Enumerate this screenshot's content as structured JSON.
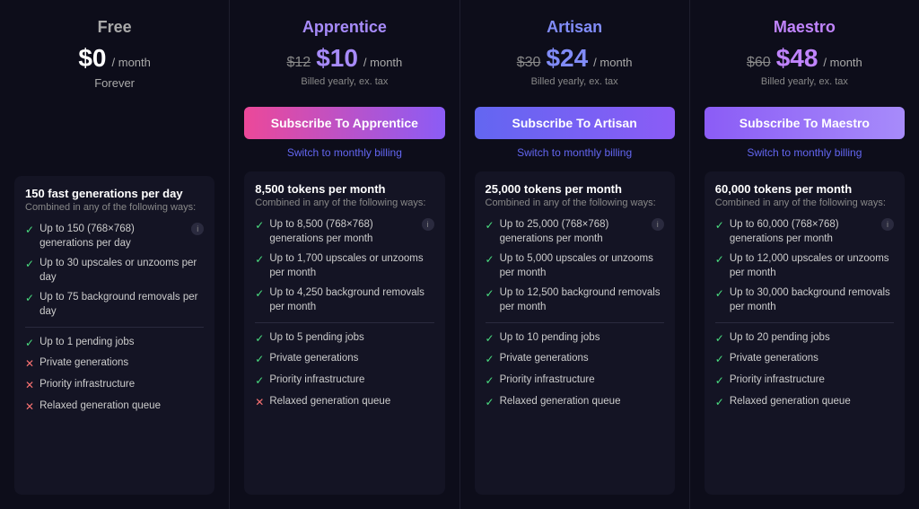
{
  "plans": [
    {
      "id": "free",
      "name": "Free",
      "name_class": "free",
      "price_original": null,
      "price_current": "$0",
      "price_current_class": "free",
      "price_period": "/ month",
      "price_note": null,
      "forever_note": "Forever",
      "subscribe_label": null,
      "switch_billing": null,
      "main_feature": "150 fast generations per day",
      "sub_feature": "Combined in any of the following ways:",
      "features_group1": [
        {
          "check": true,
          "text": "Up to 150 (768×768) generations per day",
          "info": true
        },
        {
          "check": true,
          "text": "Up to 30 upscales or unzooms per day"
        },
        {
          "check": true,
          "text": "Up to 75 background removals per day"
        }
      ],
      "features_group2": [
        {
          "check": true,
          "text": "Up to 1 pending jobs"
        },
        {
          "check": false,
          "text": "Private generations"
        },
        {
          "check": false,
          "text": "Priority infrastructure"
        },
        {
          "check": false,
          "text": "Relaxed generation queue"
        }
      ]
    },
    {
      "id": "apprentice",
      "name": "Apprentice",
      "name_class": "apprentice",
      "price_original": "$12",
      "price_current": "$10",
      "price_current_class": "apprentice",
      "price_period": "/ month",
      "price_note": "Billed yearly, ex. tax",
      "forever_note": null,
      "subscribe_label": "Subscribe To Apprentice",
      "subscribe_class": "btn-apprentice",
      "switch_billing": "Switch to monthly billing",
      "main_feature": "8,500 tokens per month",
      "sub_feature": "Combined in any of the following ways:",
      "features_group1": [
        {
          "check": true,
          "text": "Up to 8,500 (768×768) generations per month",
          "info": true
        },
        {
          "check": true,
          "text": "Up to 1,700 upscales or unzooms per month"
        },
        {
          "check": true,
          "text": "Up to 4,250 background removals per month"
        }
      ],
      "features_group2": [
        {
          "check": true,
          "text": "Up to 5 pending jobs"
        },
        {
          "check": true,
          "text": "Private generations"
        },
        {
          "check": true,
          "text": "Priority infrastructure"
        },
        {
          "check": false,
          "text": "Relaxed generation queue"
        }
      ]
    },
    {
      "id": "artisan",
      "name": "Artisan",
      "name_class": "artisan",
      "price_original": "$30",
      "price_current": "$24",
      "price_current_class": "artisan",
      "price_period": "/ month",
      "price_note": "Billed yearly, ex. tax",
      "forever_note": null,
      "subscribe_label": "Subscribe To Artisan",
      "subscribe_class": "btn-artisan",
      "switch_billing": "Switch to monthly billing",
      "main_feature": "25,000 tokens per month",
      "sub_feature": "Combined in any of the following ways:",
      "features_group1": [
        {
          "check": true,
          "text": "Up to 25,000 (768×768) generations per month",
          "info": true
        },
        {
          "check": true,
          "text": "Up to 5,000 upscales or unzooms per month"
        },
        {
          "check": true,
          "text": "Up to 12,500 background removals per month"
        }
      ],
      "features_group2": [
        {
          "check": true,
          "text": "Up to 10 pending jobs"
        },
        {
          "check": true,
          "text": "Private generations"
        },
        {
          "check": true,
          "text": "Priority infrastructure"
        },
        {
          "check": true,
          "text": "Relaxed generation queue"
        }
      ]
    },
    {
      "id": "maestro",
      "name": "Maestro",
      "name_class": "maestro",
      "price_original": "$60",
      "price_current": "$48",
      "price_current_class": "maestro",
      "price_period": "/ month",
      "price_note": "Billed yearly, ex. tax",
      "forever_note": null,
      "subscribe_label": "Subscribe To Maestro",
      "subscribe_class": "btn-maestro",
      "switch_billing": "Switch to monthly billing",
      "main_feature": "60,000 tokens per month",
      "sub_feature": "Combined in any of the following ways:",
      "features_group1": [
        {
          "check": true,
          "text": "Up to 60,000 (768×768) generations per month",
          "info": true
        },
        {
          "check": true,
          "text": "Up to 12,000 upscales or unzooms per month"
        },
        {
          "check": true,
          "text": "Up to 30,000 background removals per month"
        }
      ],
      "features_group2": [
        {
          "check": true,
          "text": "Up to 20 pending jobs"
        },
        {
          "check": true,
          "text": "Private generations"
        },
        {
          "check": true,
          "text": "Priority infrastructure"
        },
        {
          "check": true,
          "text": "Relaxed generation queue"
        }
      ]
    }
  ]
}
